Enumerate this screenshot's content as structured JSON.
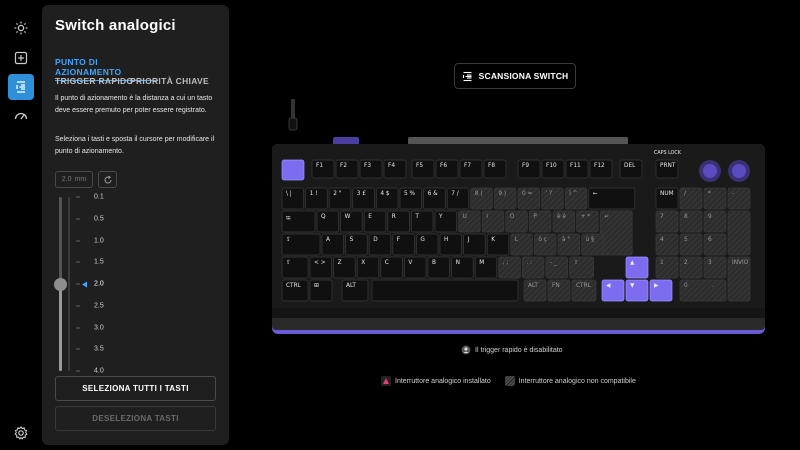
{
  "sidebar": {
    "items": [
      {
        "icon": "sun-icon"
      },
      {
        "icon": "plus-square-icon"
      },
      {
        "icon": "analog-switch-icon",
        "active": true
      },
      {
        "icon": "speedometer-icon"
      }
    ],
    "settings_icon": "gear-icon"
  },
  "panel": {
    "title": "Switch analogici",
    "tabs": {
      "actuation": "PUNTO DI AZIONAMENTO",
      "rapid_trigger": "TRIGGER RAPIDO",
      "key_priority": "PRIORITÀ CHIAVE"
    },
    "description1": "Il punto di azionamento è la distanza a cui un tasto deve essere premuto per poter essere registrato.",
    "description2": "Seleziona i tasti e sposta il cursore per modificare il punto di azionamento.",
    "mm_value": "2.0",
    "mm_unit": "mm",
    "ticks": [
      "0.1",
      "0.5",
      "1.0",
      "1.5",
      "2.0",
      "2.5",
      "3.0",
      "3.5",
      "4.0"
    ],
    "selected_value": 2.0,
    "select_all": "SELEZIONA TUTTI I TASTI",
    "deselect": "DESELEZIONA TASTI"
  },
  "main": {
    "scan_button": "SCANSIONA SWITCH",
    "rapid_trigger_status": "Il trigger rapido è disabilitato",
    "legend": {
      "installed": "Interruttore analogico installato",
      "not_compatible": "Interruttore analogico non compatibile"
    },
    "accent": "#7b6cf0"
  },
  "keyboard": {
    "caps_label": "CAPS LOCK",
    "fn_row": [
      "F1",
      "F2",
      "F3",
      "F4",
      "F5",
      "F6",
      "F7",
      "F8",
      "F9",
      "F10",
      "F11",
      "F12",
      "DEL",
      "PRNT"
    ],
    "number_row": [
      "\\ |",
      "1 !",
      "2 \"",
      "3 £",
      "4 $",
      "5 %",
      "6 &",
      "7 /",
      "8 (",
      "9 )",
      "0 =",
      "' ?",
      "ì ^",
      "←"
    ],
    "numpad_row1": [
      "NUM",
      "/",
      "*",
      "-"
    ],
    "q_row": [
      "⭾",
      "Q",
      "W",
      "E",
      "R",
      "T",
      "Y",
      "U",
      "I",
      "O",
      "P",
      "è é",
      "+ *"
    ],
    "numpad_row2": [
      "7",
      "8",
      "9"
    ],
    "a_row": [
      "⇪",
      "A",
      "S",
      "D",
      "F",
      "G",
      "H",
      "J",
      "K",
      "L",
      "ò ç",
      "à °",
      "ù §",
      "↵"
    ],
    "numpad_row3": [
      "4",
      "5",
      "6",
      "+"
    ],
    "z_row": [
      "⇧",
      "< >",
      "Z",
      "X",
      "C",
      "V",
      "B",
      "N",
      "M",
      ", ;",
      ". :",
      "- _",
      "⇧"
    ],
    "numpad_row4": [
      "1",
      "2",
      "3"
    ],
    "bottom_row": [
      "CTRL",
      "⊞",
      "ALT",
      "",
      "ALT",
      "FN",
      "CTRL"
    ],
    "numpad_row5": [
      "0",
      ".",
      "INVIO"
    ]
  }
}
